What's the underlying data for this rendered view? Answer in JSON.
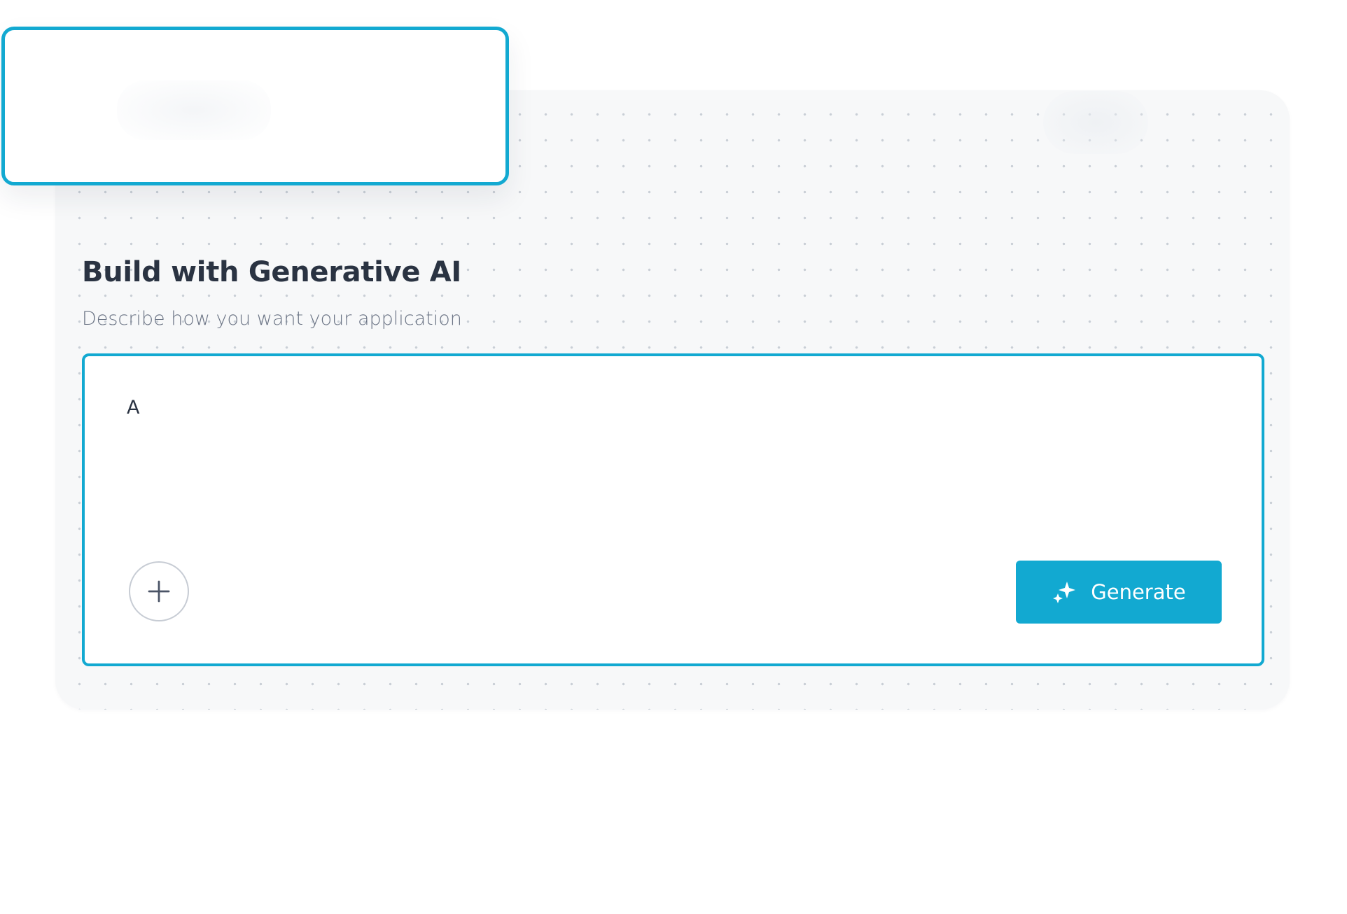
{
  "builder": {
    "title": "Build with Generative AI",
    "subtitle": "Describe how you want your application",
    "prompt_value": "A",
    "generate_label": "Generate"
  },
  "icons": {
    "add": "plus-icon",
    "generate": "sparkle-icon"
  },
  "colors": {
    "accent": "#12a9d1",
    "card_background": "#f7f8f9",
    "title_text": "#2a3342",
    "subtitle_text": "#6a7384"
  }
}
